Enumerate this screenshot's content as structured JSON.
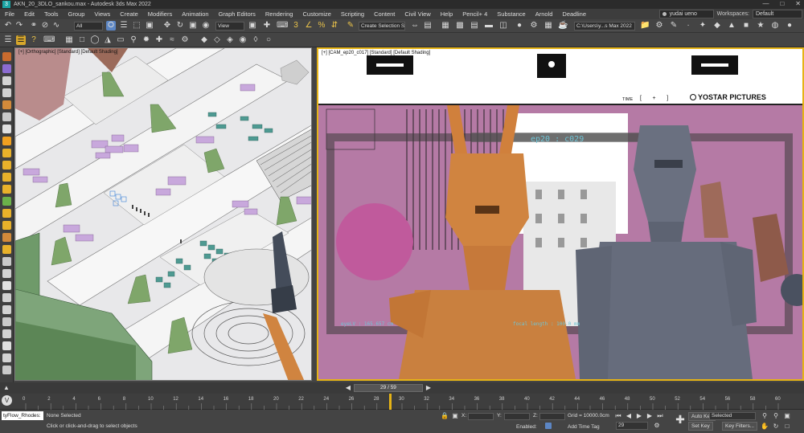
{
  "window": {
    "title": "AKN_20_3DLO_sankou.max - Autodesk 3ds Max 2022",
    "logo": "3"
  },
  "menu": [
    "File",
    "Edit",
    "Tools",
    "Group",
    "Views",
    "Create",
    "Modifiers",
    "Animation",
    "Graph Editors",
    "Rendering",
    "Customize",
    "Scripting",
    "Content",
    "Civil View",
    "Help",
    "Pencil+ 4",
    "Substance",
    "Arnold",
    "Deadline"
  ],
  "user": {
    "name": "yudai ueno",
    "workspaces_label": "Workspaces:",
    "workspace": "Default"
  },
  "toolbar": {
    "selection_filter": "All",
    "reference_coord": "View",
    "named_selection": "Create Selection Se",
    "project_path": "C:\\Users\\y...s Max 2022"
  },
  "viewports": {
    "left_label": "[+] [Orthographic] [Standard] [Default Shading]",
    "right_label": "[+] [CAM_ep20_c017] [Standard] [Default Shading]",
    "overlay": {
      "time_label": "TIME",
      "brand": "YOSTAR PICTURES",
      "shot": "ep20 : c029",
      "eye_level": "eyeLV : 165.657 cm",
      "focal_length": "focal length : 100.0 mm"
    }
  },
  "timeline": {
    "frame_display": "29 / 59",
    "ticks": [
      "0",
      "2",
      "4",
      "6",
      "8",
      "10",
      "12",
      "14",
      "16",
      "18",
      "20",
      "22",
      "24",
      "26",
      "28",
      "30",
      "32",
      "34",
      "36",
      "38",
      "40",
      "42",
      "44",
      "46",
      "48",
      "50",
      "52",
      "54",
      "56",
      "58",
      "60"
    ]
  },
  "status": {
    "maxscript": "tyFlow_Rhodes:",
    "selection": "None Selected",
    "prompt": "Click or click-and-drag to select objects",
    "x_label": "X:",
    "y_label": "Y:",
    "z_label": "Z:",
    "grid": "Grid = 10000.0cm",
    "enabled_label": "Enabled:",
    "add_time_tag": "Add Time Tag",
    "current_frame": "29",
    "auto_key": "Auto Key",
    "set_key": "Set Key",
    "key_mode": "Selected",
    "key_filters": "Key Filters..."
  },
  "colors": {
    "accent": "#e5b316",
    "cam_bg": "#b57aa5"
  }
}
